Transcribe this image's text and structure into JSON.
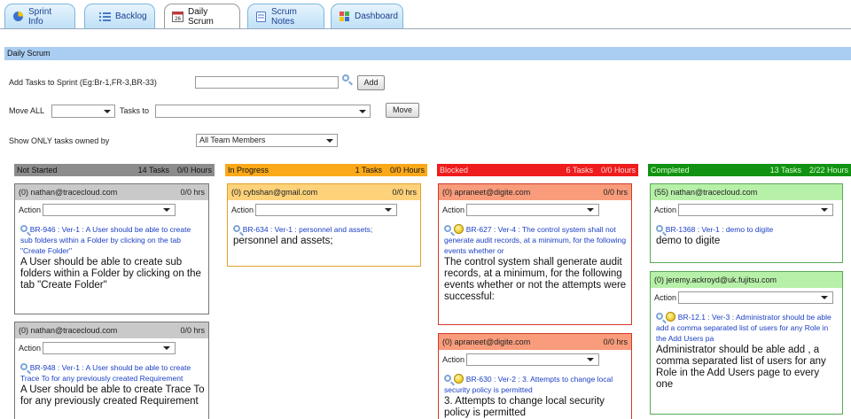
{
  "tabs": [
    {
      "label": "Sprint Info",
      "icon": "sprint-info-icon"
    },
    {
      "label": "Backlog",
      "icon": "backlog-list-icon"
    },
    {
      "label": "Daily Scrum",
      "icon": "calendar-icon",
      "active": true
    },
    {
      "label": "Scrum Notes",
      "icon": "notes-icon"
    },
    {
      "label": "Dashboard",
      "icon": "dashboard-icon"
    }
  ],
  "section_title": "Daily Scrum",
  "controls": {
    "add_tasks_label": "Add Tasks to Sprint (Eg:Br-1,FR-3,BR-33)",
    "add_tasks_value": "",
    "add_button": "Add",
    "move_all_label": "Move ALL",
    "move_all_value": "",
    "tasks_to_label": "Tasks to",
    "tasks_to_value": "",
    "move_button": "Move",
    "show_only_label": "Show ONLY tasks owned by",
    "owner_value": "All Team Members"
  },
  "columns": [
    {
      "title": "Not Started",
      "tasks": "14 Tasks",
      "hours": "0/0 Hours",
      "color": "#8c8c8c",
      "text_color": "#111111"
    },
    {
      "title": "In Progress",
      "tasks": "1 Tasks",
      "hours": "0/0 Hours",
      "color": "#fba919",
      "text_color": "#111111"
    },
    {
      "title": "Blocked",
      "tasks": "6 Tasks",
      "hours": "0/0 Hours",
      "color": "#ee1c1c",
      "text_color": "#ffd9d9"
    },
    {
      "title": "Completed",
      "tasks": "13 Tasks",
      "hours": "2/22 Hours",
      "color": "#129212",
      "text_color": "#d9ffd0"
    }
  ],
  "cards": {
    "c1": {
      "owner": "(0)  nathan@tracecloud.com",
      "hrs": "0/0 hrs",
      "action_label": "Action",
      "link": "BR-946 : Ver-1 : A User should be able to create sub folders within a Folder by clicking on the tab \"Create Folder\"",
      "desc": "A User should be able to create sub folders within a Folder by clicking on the tab \"Create Folder\""
    },
    "c2": {
      "owner": "(0)  nathan@tracecloud.com",
      "hrs": "0/0 hrs",
      "action_label": "Action",
      "link": "BR-948 : Ver-1 : A User should be able to create Trace To for any previously created Requirement",
      "desc": "A User should be able to create Trace To for any previously created Requirement"
    },
    "c3": {
      "owner": "(0)  cybshan@gmail.com",
      "hrs": "0/0 hrs",
      "action_label": "Action",
      "link": "BR-634 : Ver-1 : personnel and assets;",
      "desc": "personnel and assets;"
    },
    "c4": {
      "owner": "(0)  apraneet@digite.com",
      "hrs": "0/0 hrs",
      "action_label": "Action",
      "link": "BR-627 : Ver-4 : The control system shall not generate audit records, at a minimum, for the following events whether or",
      "desc": "The control system shall generate audit records, at a minimum, for the following events whether or not the attempts were successful:"
    },
    "c5": {
      "owner": "(0)  apraneet@digite.com",
      "hrs": "0/0 hrs",
      "action_label": "Action",
      "link": "BR-630 : Ver-2 : 3.     Attempts to change local security policy is permitted",
      "desc": "3.     Attempts to change local security policy is permitted"
    },
    "c6": {
      "owner": "(55)  nathan@tracecloud.com",
      "hrs": "",
      "action_label": "Action",
      "link": "BR-1368 : Ver-1 : demo to digite",
      "desc": "demo to digite"
    },
    "c7": {
      "owner": "(0)  jeremy.ackroyd@uk.fujitsu.com",
      "hrs": "",
      "action_label": "Action",
      "link": "BR-12.1 : Ver-3 : Administrator should be able add a comma separated list of users for any Role in the Add Users pa",
      "desc": "Administrator should be able add , a comma separated list of users for any Role in the Add Users page to every one"
    }
  }
}
